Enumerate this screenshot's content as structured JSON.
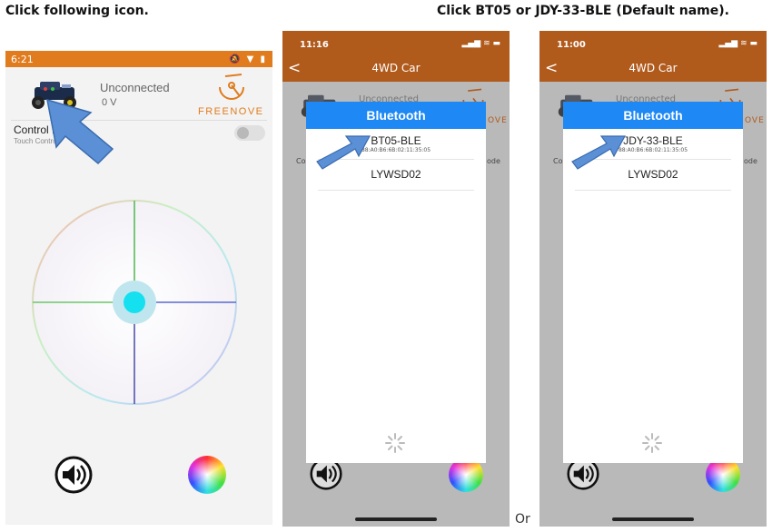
{
  "captions": {
    "left": "Click following icon.",
    "right": "Click BT05 or JDY-33-BLE (Default name).",
    "or": "Or"
  },
  "android": {
    "status_time": "6:21",
    "status_icons": "🔕 ▼ ▮",
    "connection_status": "Unconnected",
    "voltage": "0 V",
    "logo_text": "FREENOVE",
    "control_mode_title": "Control M",
    "control_mode_subtitle": "Touch Control",
    "icons": [
      "car-icon",
      "speaker-icon",
      "color-wheel-icon"
    ]
  },
  "ios_1": {
    "status_time": "11:16",
    "status_icons": "▂▄▆ ≋ ▬",
    "nav_title": "4WD Car",
    "back_glyph": "<",
    "bg_unconnected": "Unconnected",
    "bg_logo_fragment": "OVE",
    "bg_left_fragment": "Co",
    "bg_right_fragment": "ode",
    "modal": {
      "title": "Bluetooth",
      "devices": [
        {
          "name": "BT05-BLE",
          "mac": "88:A0:B6:6B:02:11:35:05"
        },
        {
          "name": "LYWSD02",
          "mac": ""
        }
      ]
    }
  },
  "ios_2": {
    "status_time": "11:00",
    "status_icons": "▂▄▆ ≋ ▬",
    "nav_title": "4WD Car",
    "back_glyph": "<",
    "bg_unconnected": "Unconnected",
    "bg_logo_fragment": "OVE",
    "bg_left_fragment": "Co",
    "bg_right_fragment": "ode",
    "modal": {
      "title": "Bluetooth",
      "devices": [
        {
          "name": "JDY-33-BLE",
          "mac": "88:A0:B6:6B:02:11:35:05"
        },
        {
          "name": "LYWSD02",
          "mac": ""
        }
      ]
    }
  },
  "colors": {
    "android_status": "#e07c1e",
    "ios_header": "#b05a1c",
    "bluetooth_header": "#1e88f5",
    "annotation_arrow": "#5b8fd6",
    "joystick_knob": "#14e0f0"
  }
}
